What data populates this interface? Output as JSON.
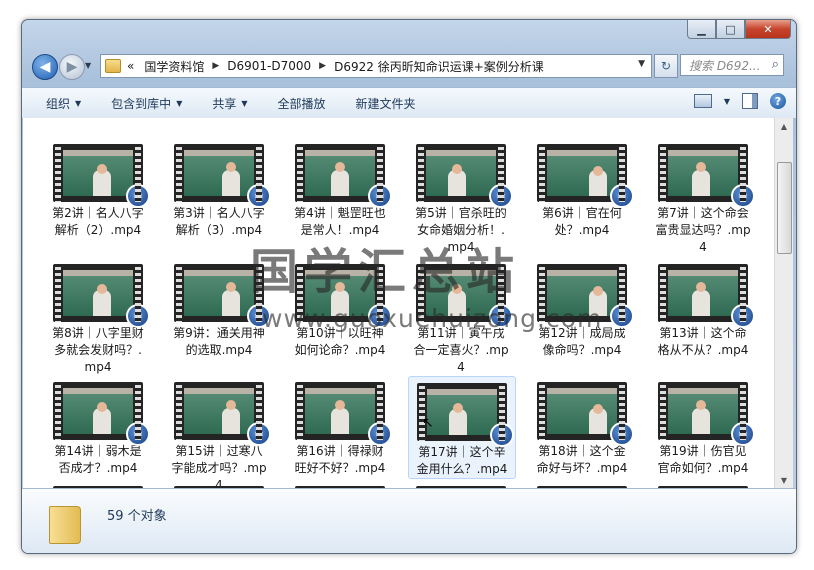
{
  "window": {
    "caption_buttons": {
      "minimize": "▁",
      "maximize": "□",
      "close": "✕"
    }
  },
  "nav": {
    "back_icon": "◀",
    "forward_icon": "▶",
    "history_icon": "▼",
    "breadcrumb_prefix": "«",
    "breadcrumb": [
      "国学资料馆",
      "D6901-D7000",
      "D6922 徐丙昕知命识运课+案例分析课"
    ],
    "separator": "▶",
    "dropdown_icon": "▼",
    "refresh_icon": "↻",
    "search_placeholder": "搜索 D692...",
    "search_icon": "⌕"
  },
  "toolbar": {
    "organize": "组织",
    "include_in_library": "包含到库中",
    "share": "共享",
    "play_all": "全部播放",
    "new_folder": "新建文件夹",
    "dropdown_arrow": "▼",
    "help": "?"
  },
  "files": [
    "第2讲｜名人八字解析（2）.mp4",
    "第3讲｜名人八字解析（3）.mp4",
    "第4讲｜魁罡旺也是常人！.mp4",
    "第5讲｜官杀旺的女命婚姻分析！.mp4",
    "第6讲｜官在何处？.mp4",
    "第7讲｜这个命会富贵显达吗？.mp4",
    "第8讲｜八字里财多就会发财吗？.mp4",
    "第9讲：通关用神的选取.mp4",
    "第10讲｜以旺神如何论命？.mp4",
    "第11讲｜寅午戌合一定喜火？.mp4",
    "第12讲｜成局成像命吗？.mp4",
    "第13讲｜这个命格从不从？.mp4",
    "第14讲｜弱木是否成才？.mp4",
    "第15讲｜过寒八字能成才吗？.mp4",
    "第16讲｜得禄财旺好不好？.mp4",
    "第17讲｜这个辛金用什么？.mp4",
    "第18讲｜这个金命好与坏？.mp4",
    "第19讲｜伤官见官命如何？.mp4"
  ],
  "file_badge_icon": "film-reel-icon",
  "status": {
    "count": "59 个对象"
  },
  "watermark": {
    "line1": "国学汇总站",
    "line2": "www.guoxuehuizong.com"
  },
  "scrollbar": {
    "up": "▲",
    "down": "▼"
  },
  "cursor_icon": "↖"
}
